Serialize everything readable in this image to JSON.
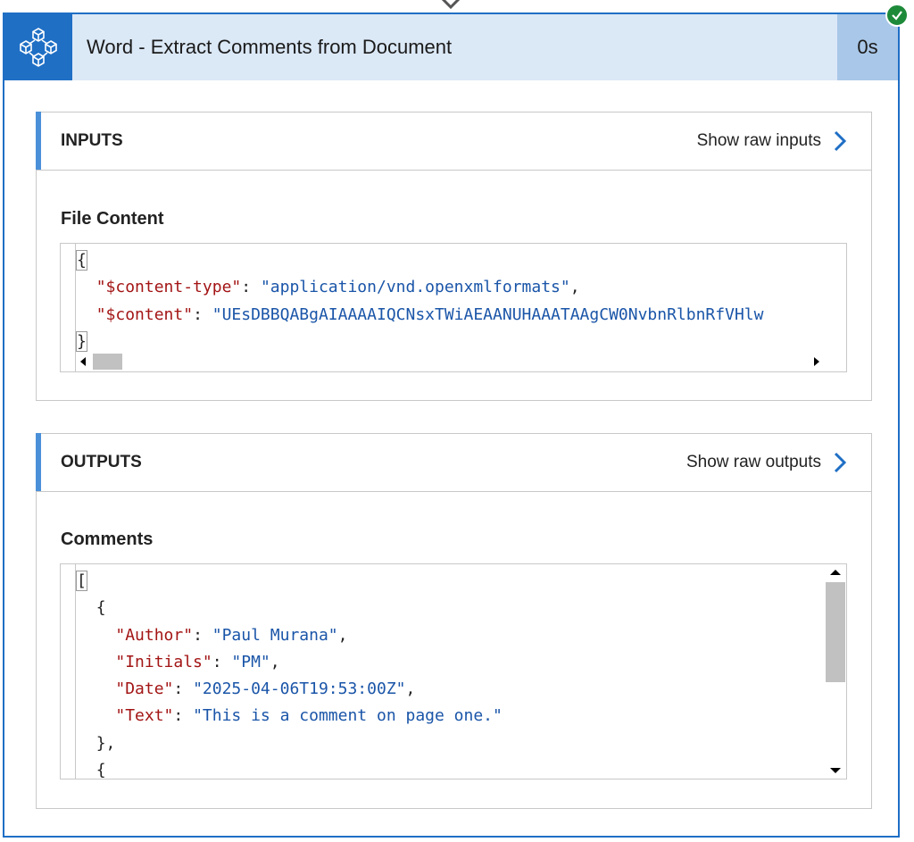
{
  "card": {
    "title": "Word - Extract Comments from Document",
    "duration": "0s",
    "status_icon": "check-icon",
    "app_icon": "word-connector-icon"
  },
  "inputs": {
    "label": "INPUTS",
    "raw_link": "Show raw inputs",
    "field_label": "File Content",
    "code": {
      "open": "{",
      "key1": "\"$content-type\"",
      "val1": "\"application/vnd.openxmlformats\"",
      "key2": "\"$content\"",
      "val2": "\"UEsDBBQABgAIAAAAIQCNsxTWiAEAANUHAAATAAgCW0NvbnRlbnRfVHlw",
      "close": "}"
    }
  },
  "outputs": {
    "label": "OUTPUTS",
    "raw_link": "Show raw outputs",
    "field_label": "Comments",
    "code": {
      "open": "[",
      "obj_open": "{",
      "author_key": "\"Author\"",
      "author_val": "\"Paul Murana\"",
      "initials_key": "\"Initials\"",
      "initials_val": "\"PM\"",
      "date_key": "\"Date\"",
      "date_val": "\"2025-04-06T19:53:00Z\"",
      "text_key": "\"Text\"",
      "text_val": "\"This is a comment on page one.\"",
      "obj_close": "},",
      "obj2_open": "{"
    }
  },
  "colors": {
    "accent": "#1f6fc5",
    "header_bg": "#dbe8f6",
    "duration_bg": "#a9c7e8",
    "success": "#1d8a3a",
    "json_key": "#a31515",
    "json_value": "#1a55a8"
  }
}
